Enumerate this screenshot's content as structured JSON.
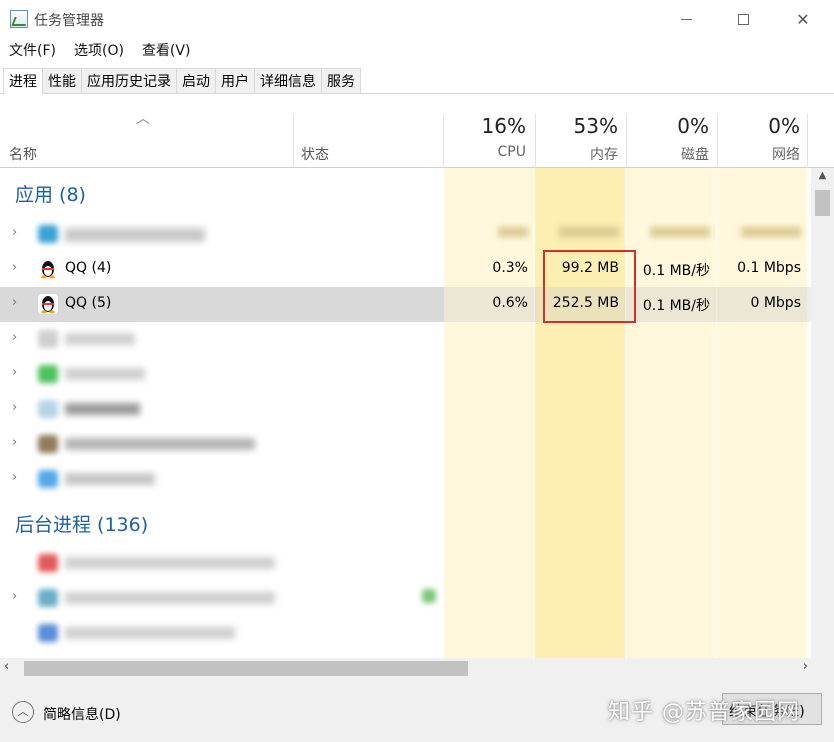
{
  "window": {
    "title": "任务管理器",
    "minimize": "—",
    "maximize": "☐",
    "close": "✕"
  },
  "menu": [
    "文件(F)",
    "选项(O)",
    "查看(V)"
  ],
  "tabs": [
    "进程",
    "性能",
    "应用历史记录",
    "启动",
    "用户",
    "详细信息",
    "服务"
  ],
  "active_tab": "进程",
  "columns": {
    "name": "名称",
    "status": "状态",
    "cpu": {
      "pct": "16%",
      "label": "CPU"
    },
    "memory": {
      "pct": "53%",
      "label": "内存"
    },
    "disk": {
      "pct": "0%",
      "label": "磁盘"
    },
    "network": {
      "pct": "0%",
      "label": "网络"
    }
  },
  "groups": {
    "apps": "应用 (8)",
    "background": "后台进程 (136)"
  },
  "processes": [
    {
      "name": "QQ (4)",
      "cpu": "0.3%",
      "memory": "99.2 MB",
      "disk": "0.1 MB/秒",
      "network": "0.1 Mbps"
    },
    {
      "name": "QQ (5)",
      "cpu": "0.6%",
      "memory": "252.5 MB",
      "disk": "0.1 MB/秒",
      "network": "0 Mbps"
    }
  ],
  "footer": {
    "fewer_details": "简略信息(D)",
    "watermark": "知乎 @苏普家园网",
    "end_task": "结束任务(E)"
  },
  "colors": {
    "group_title": "#1f5fa8",
    "heat_light": "#fff8dc",
    "heat_medium": "#fdeeb2",
    "selected_row": "#d9d9d9",
    "highlight_border": "#d0312d"
  }
}
